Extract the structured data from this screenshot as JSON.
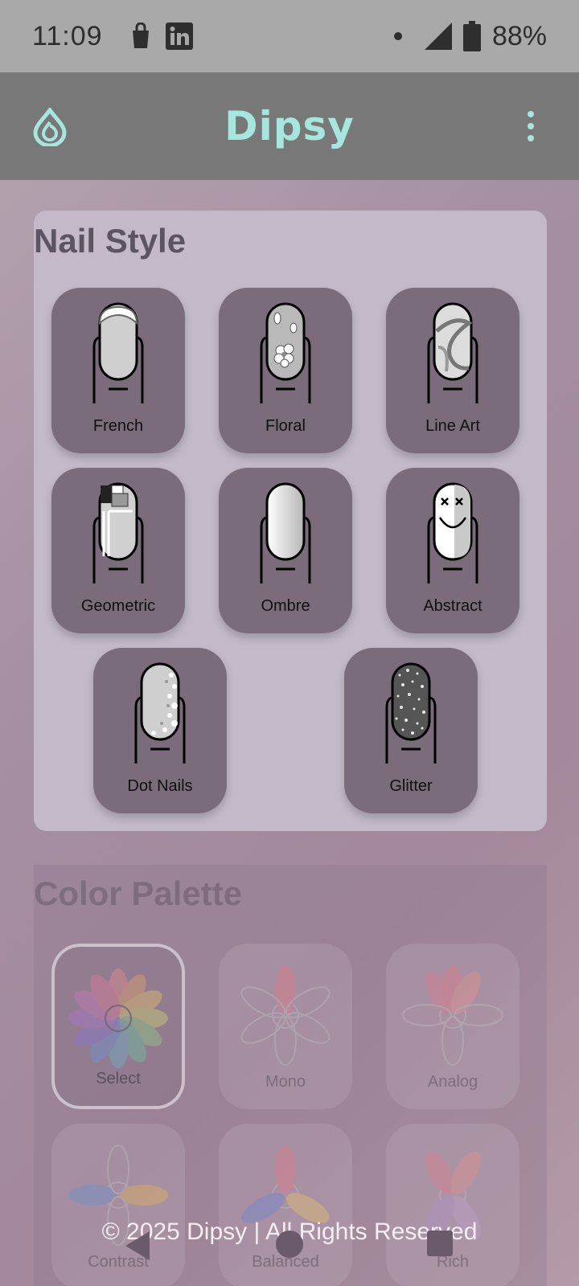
{
  "status_bar": {
    "time": "11:09",
    "battery": "88%",
    "icons": [
      "shopping-bag-icon",
      "linkedin-icon",
      "notification-dot-icon",
      "signal-icon",
      "battery-icon"
    ]
  },
  "app_bar": {
    "title": "Dipsy",
    "accent_color": "#a6e6dc"
  },
  "nail_style": {
    "title": "Nail Style",
    "options": [
      {
        "label": "French"
      },
      {
        "label": "Floral"
      },
      {
        "label": "Line Art"
      },
      {
        "label": "Geometric"
      },
      {
        "label": "Ombre"
      },
      {
        "label": "Abstract"
      },
      {
        "label": "Dot Nails"
      },
      {
        "label": "Glitter"
      }
    ]
  },
  "color_palette": {
    "title": "Color Palette",
    "options": [
      {
        "label": "Select",
        "selected": true
      },
      {
        "label": "Mono"
      },
      {
        "label": "Analog"
      },
      {
        "label": "Contrast"
      },
      {
        "label": "Balanced"
      },
      {
        "label": "Rich"
      }
    ]
  },
  "footer": {
    "text": "© 2025 Dipsy | All Rights Reserved"
  }
}
